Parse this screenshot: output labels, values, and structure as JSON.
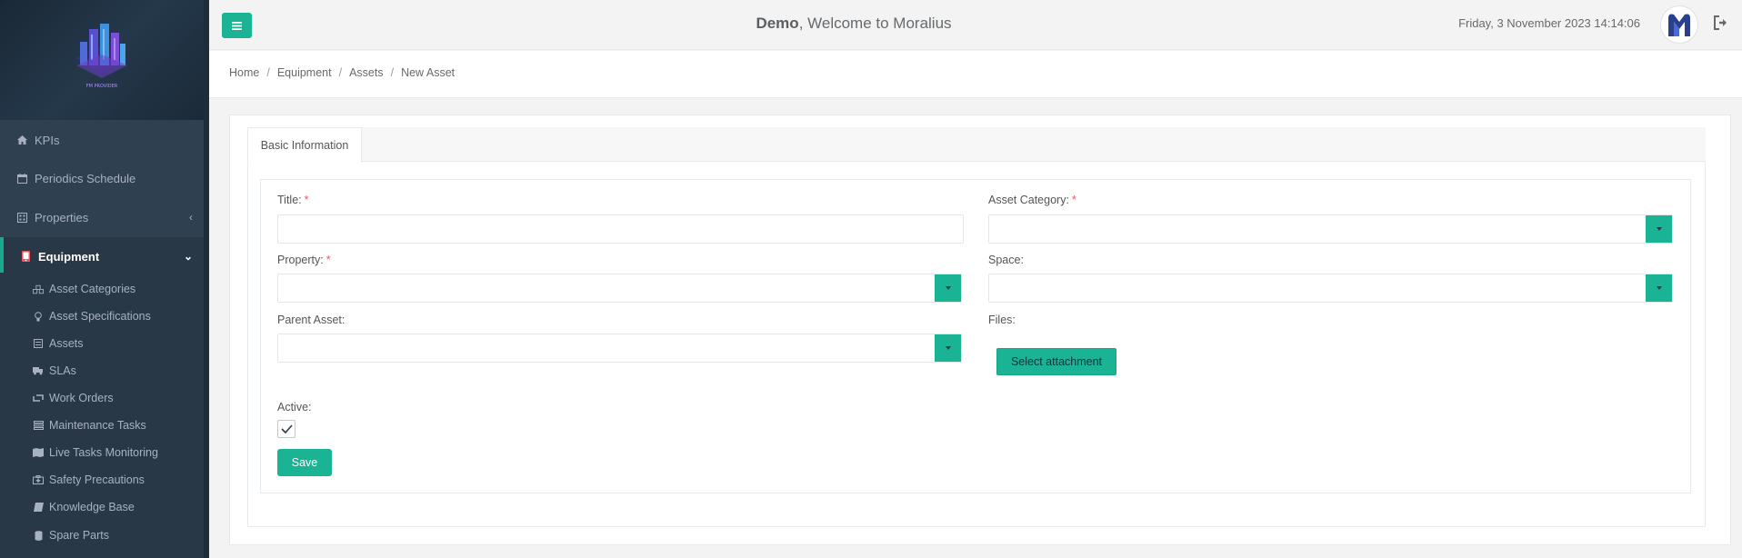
{
  "header": {
    "welcome_user": "Demo",
    "welcome_rest": ", Welcome to Moralius",
    "datetime": "Friday, 3 November 2023 14:14:06"
  },
  "sidebar": {
    "items": [
      {
        "label": "KPIs",
        "icon": "home-icon"
      },
      {
        "label": "Periodics Schedule",
        "icon": "calendar-icon"
      },
      {
        "label": "Properties",
        "icon": "building-icon"
      },
      {
        "label": "Equipment",
        "icon": "tablet-icon"
      }
    ],
    "submenu": [
      {
        "label": "Asset Categories",
        "icon": "cubes-icon"
      },
      {
        "label": "Asset Specifications",
        "icon": "lightbulb-icon"
      },
      {
        "label": "Assets",
        "icon": "list-icon"
      },
      {
        "label": "SLAs",
        "icon": "truck-icon"
      },
      {
        "label": "Work Orders",
        "icon": "retweet-icon"
      },
      {
        "label": "Maintenance Tasks",
        "icon": "tasks-icon"
      },
      {
        "label": "Live Tasks Monitoring",
        "icon": "map-icon"
      },
      {
        "label": "Safety Precautions",
        "icon": "medkit-icon"
      },
      {
        "label": "Knowledge Base",
        "icon": "book-icon"
      },
      {
        "label": "Spare Parts",
        "icon": "database-icon"
      }
    ]
  },
  "breadcrumb": [
    "Home",
    "Equipment",
    "Assets",
    "New Asset"
  ],
  "tabs": [
    {
      "label": "Basic Information"
    }
  ],
  "form": {
    "title_label": "Title:",
    "asset_category_label": "Asset Category:",
    "property_label": "Property:",
    "space_label": "Space:",
    "parent_asset_label": "Parent Asset:",
    "files_label": "Files:",
    "attach_label": "Select attachment",
    "active_label": "Active:",
    "active_checked": true,
    "save_label": "Save",
    "required_mark": "*"
  },
  "colors": {
    "accent": "#1ab394",
    "sidebar": "#2f4050",
    "required": "#ed5565"
  }
}
